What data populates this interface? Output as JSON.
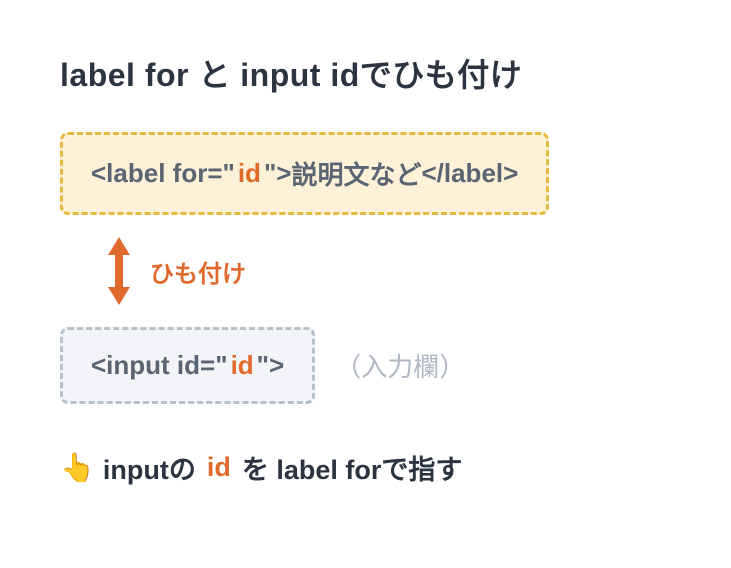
{
  "title": "label for と input idでひも付け",
  "label_box": {
    "open1": "<label for=\"",
    "id": "id",
    "open2": "\">",
    "content": "説明文など",
    "close": "</label>"
  },
  "connector": {
    "label": "ひも付け"
  },
  "input_box": {
    "open1": "<input id=\"",
    "id": "id",
    "open2": "\">"
  },
  "placeholder": "（入力欄）",
  "footer": {
    "emoji": "👆",
    "t1": "inputの",
    "id": "id",
    "t2": "を label forで指す"
  },
  "colors": {
    "accent_orange": "#e06a2c",
    "label_border": "#e6b93f",
    "label_bg": "#fdf2d7",
    "input_border": "#b8c0cc",
    "input_bg": "#f2f4f8",
    "text_dark": "#2b3440",
    "text_muted": "#5a6472"
  }
}
